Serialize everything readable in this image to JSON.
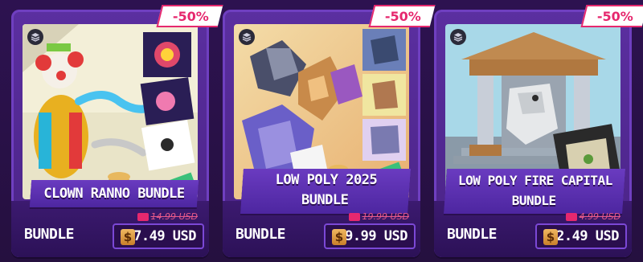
{
  "colors": {
    "background": "#2a1148",
    "card": "#5b2fa0",
    "discount": "#e6286e",
    "price_box": "#2a0e4e",
    "old_price": "#e85a8a"
  },
  "cards": [
    {
      "discount": "-50%",
      "title": "CLOWN RANNO BUNDLE",
      "type": "BUNDLE",
      "old_price": "14.99 USD",
      "price": "7.49 USD",
      "currency_icon": "$"
    },
    {
      "discount": "-50%",
      "title_line1": "LOW POLY 2025",
      "title_line2": "BUNDLE",
      "type": "BUNDLE",
      "old_price": "19.99 USD",
      "price": "9.99 USD",
      "currency_icon": "$"
    },
    {
      "discount": "-50%",
      "title_line1": "LOW POLY FIRE CAPITAL",
      "title_line2": "BUNDLE",
      "type": "BUNDLE",
      "old_price": "4.99 USD",
      "price": "2.49 USD",
      "currency_icon": "$"
    }
  ]
}
